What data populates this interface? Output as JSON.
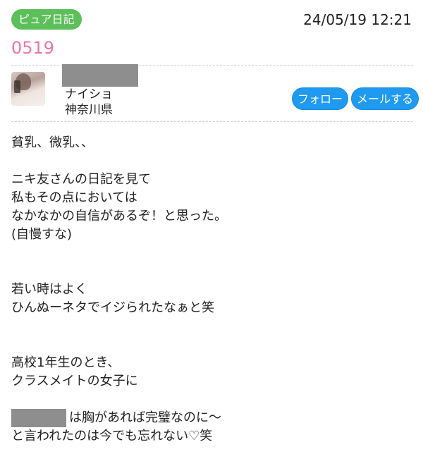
{
  "header": {
    "category_badge": "ピュア日記",
    "datetime": "24/05/19 12:21",
    "entry_title": "0519"
  },
  "author": {
    "name": "ナイショ",
    "location": "神奈川県",
    "follow_label": "フォロー",
    "mail_label": "メールする"
  },
  "body": {
    "lines": [
      "貧乳、微乳、、",
      "",
      "ニキ友さんの日記を見て",
      "私もその点においては",
      "なかなかの自信があるぞ！と思った。",
      "(自慢すな)",
      "",
      "",
      "若い時はよく",
      "ひんぬーネタでイジられたなぁと笑",
      "",
      "",
      "高校1年生のとき、",
      "クラスメイトの女子に",
      "",
      "は胸があれば完璧なのに〜",
      "と言われたのは今でも忘れない♡笑"
    ]
  },
  "colors": {
    "badge": "#5cbf5a",
    "title": "#ee74a8",
    "button": "#1f9af0"
  }
}
